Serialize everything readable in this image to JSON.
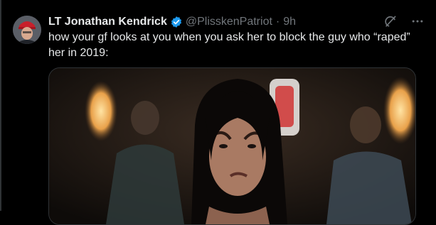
{
  "tweet": {
    "author_name": "LT Jonathan Kendrick",
    "handle": "@PlisskenPatriot",
    "separator": "·",
    "time": "9h",
    "text": "how your gf looks at you when you ask her to block the guy who “raped” her in 2019:"
  },
  "icons": {
    "verified": "verified-badge-icon",
    "grok": "grok-icon",
    "more": "more-icon"
  },
  "colors": {
    "background": "#000000",
    "verified": "#1d9bf0",
    "secondary_text": "#71767b"
  }
}
